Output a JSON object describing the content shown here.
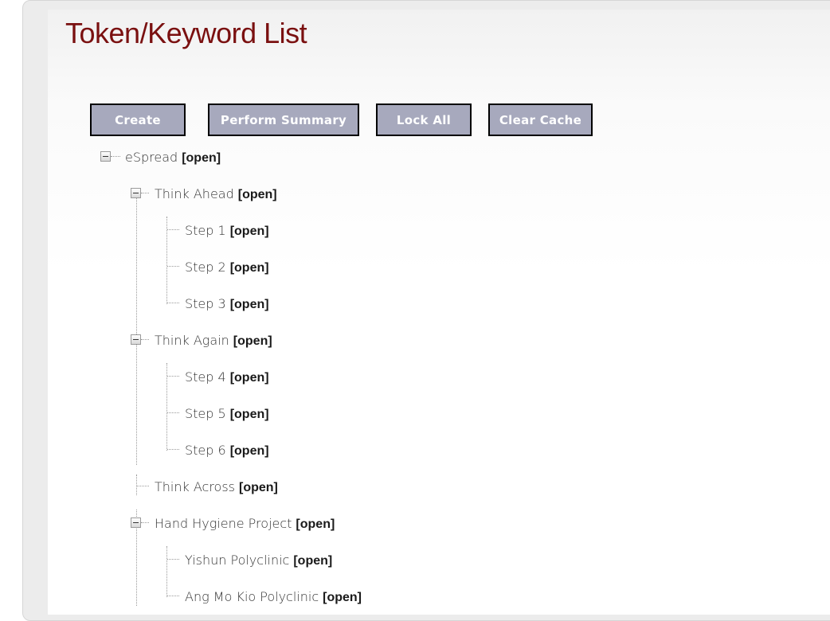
{
  "page": {
    "title": "Token/Keyword List"
  },
  "toolbar": {
    "create_label": "Create",
    "summary_label": "Perform Summary",
    "lock_label": "Lock All",
    "clear_label": "Clear Cache"
  },
  "tree": {
    "root": {
      "label": "eSpread",
      "status": "[open]"
    },
    "think_ahead": {
      "label": "Think Ahead",
      "status": "[open]",
      "children": [
        {
          "label": "Step 1",
          "status": "[open]"
        },
        {
          "label": "Step 2",
          "status": "[open]"
        },
        {
          "label": "Step 3",
          "status": "[open]"
        }
      ]
    },
    "think_again": {
      "label": "Think Again",
      "status": "[open]",
      "children": [
        {
          "label": "Step 4",
          "status": "[open]"
        },
        {
          "label": "Step 5",
          "status": "[open]"
        },
        {
          "label": "Step 6",
          "status": "[open]"
        }
      ]
    },
    "think_across": {
      "label": "Think Across",
      "status": "[open]"
    },
    "hand_hygiene": {
      "label": "Hand Hygiene Project",
      "status": "[open]",
      "children": [
        {
          "label": "Yishun Polyclinic",
          "status": "[open]"
        },
        {
          "label": "Ang Mo Kio Polyclinic",
          "status": "[open]"
        }
      ]
    }
  },
  "colors": {
    "title": "#7a1010",
    "button_bg": "#a7a9bd",
    "button_border": "#000000",
    "button_text": "#ffffff"
  }
}
